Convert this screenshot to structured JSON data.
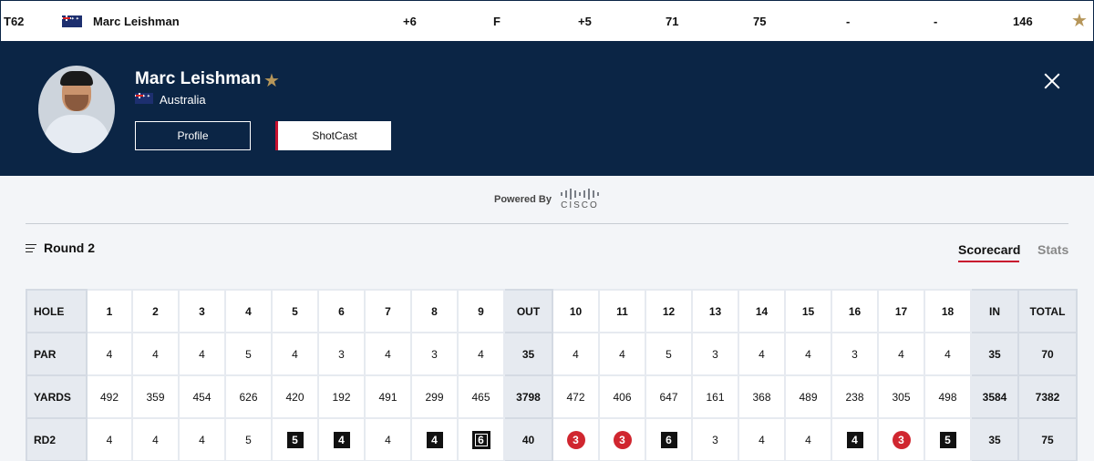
{
  "leaderboard_row": {
    "position": "T62",
    "player": "Marc Leishman",
    "total": "+6",
    "thru": "F",
    "today": "+5",
    "r1": "71",
    "r2": "75",
    "r3": "-",
    "r4": "-",
    "strokes": "146",
    "favorite_icon": "star-icon"
  },
  "player": {
    "name": "Marc Leishman",
    "country": "Australia",
    "profile_label": "Profile",
    "shotcast_label": "ShotCast"
  },
  "sponsor": {
    "powered_by": "Powered By",
    "brand": "CISCO"
  },
  "round_selector": {
    "label": "Round 2"
  },
  "tabs": {
    "scorecard": "Scorecard",
    "stats": "Stats"
  },
  "scorecard": {
    "headers": [
      "HOLE",
      "1",
      "2",
      "3",
      "4",
      "5",
      "6",
      "7",
      "8",
      "9",
      "OUT",
      "10",
      "11",
      "12",
      "13",
      "14",
      "15",
      "16",
      "17",
      "18",
      "IN",
      "TOTAL"
    ],
    "rows": [
      {
        "label": "PAR",
        "cells": [
          "4",
          "4",
          "4",
          "5",
          "4",
          "3",
          "4",
          "3",
          "4",
          "35",
          "4",
          "4",
          "5",
          "3",
          "4",
          "4",
          "3",
          "4",
          "4",
          "35",
          "70"
        ]
      },
      {
        "label": "YARDS",
        "cells": [
          "492",
          "359",
          "454",
          "626",
          "420",
          "192",
          "491",
          "299",
          "465",
          "3798",
          "472",
          "406",
          "647",
          "161",
          "368",
          "489",
          "238",
          "305",
          "498",
          "3584",
          "7382"
        ]
      },
      {
        "label": "RD2",
        "cells": [
          "4",
          "4",
          "4",
          "5",
          "5",
          "4",
          "4",
          "4",
          "6",
          "40",
          "3",
          "3",
          "6",
          "3",
          "4",
          "4",
          "4",
          "3",
          "5",
          "35",
          "75"
        ],
        "marks": [
          "",
          "",
          "",
          "",
          "bogey",
          "bogey",
          "",
          "bogey",
          "double",
          "",
          "birdie",
          "birdie",
          "bogey",
          "",
          "",
          "",
          "bogey",
          "birdie",
          "bogey",
          "",
          ""
        ]
      }
    ]
  },
  "colors": {
    "navy": "#0b2545",
    "accent_red": "#c8102e",
    "gold": "#b6965a",
    "birdie": "#d0262f"
  }
}
